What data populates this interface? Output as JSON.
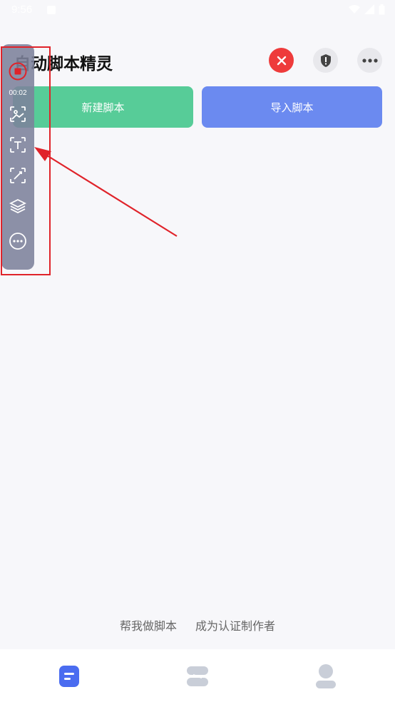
{
  "status_bar": {
    "time": "9:56"
  },
  "header": {
    "title": "自动脚本精灵",
    "close_icon": "close-icon",
    "shield_icon": "shield-icon",
    "more_icon": "more-icon"
  },
  "actions": {
    "new_script": "新建脚本",
    "import_script": "导入脚本"
  },
  "toolbar": {
    "timer": "00:02",
    "items": [
      "stop-record-icon",
      "image-scan-icon",
      "text-scan-icon",
      "edit-scan-icon",
      "layers-icon",
      "more-icon"
    ]
  },
  "footer": {
    "help_make": "帮我做脚本",
    "become_author": "成为认证制作者"
  },
  "nav": {
    "items": [
      "home-icon",
      "list-icon",
      "profile-icon"
    ]
  },
  "colors": {
    "green": "#57cc98",
    "blue": "#6b8af0",
    "red": "#ee3b3b",
    "nav_active": "#4a6cf0",
    "nav_inactive": "#c9ced8"
  }
}
